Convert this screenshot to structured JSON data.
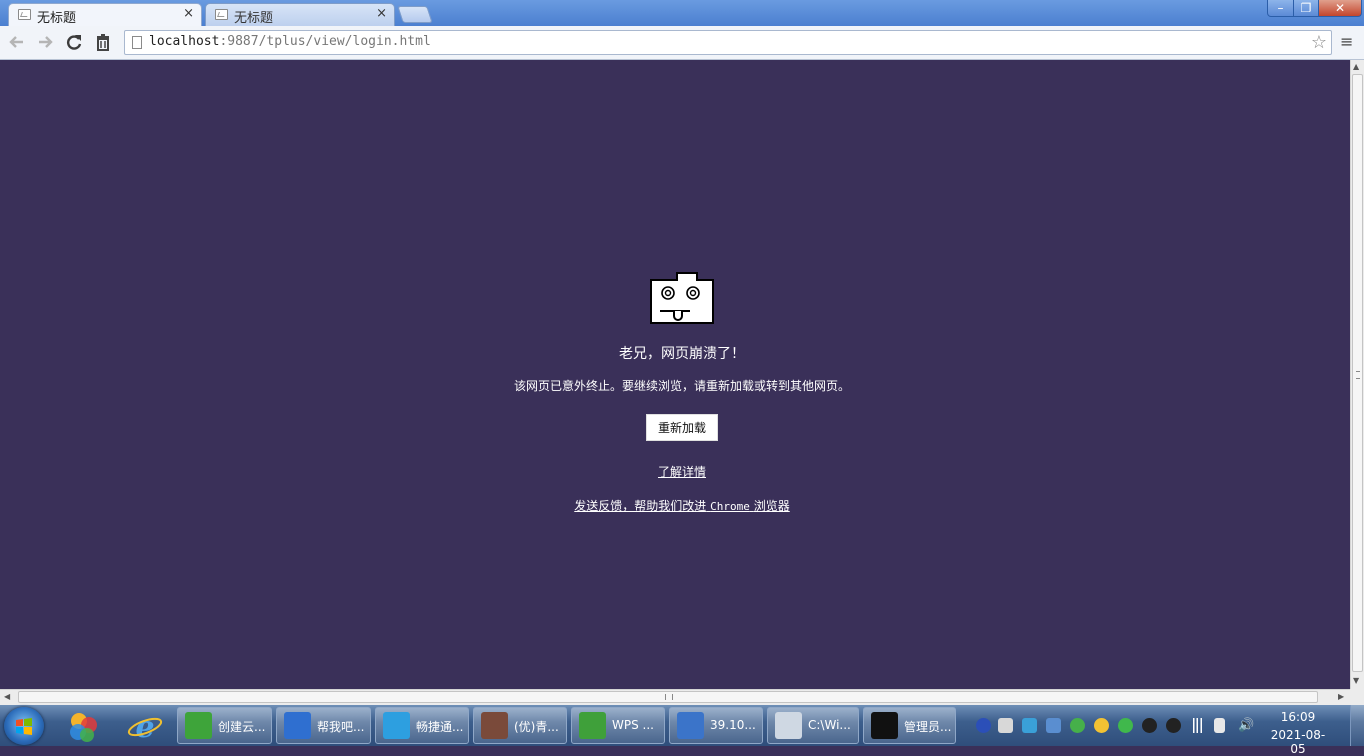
{
  "browser": {
    "tabs": [
      {
        "title": "无标题",
        "close": "×"
      },
      {
        "title": "无标题",
        "close": "×"
      }
    ],
    "window_buttons": {
      "minimize": "–",
      "maximize": "❐",
      "close": "✕"
    },
    "address": {
      "host": "localhost",
      "rest": ":9887/tplus/view/login.html"
    },
    "star": "☆",
    "menu": "≡"
  },
  "crash_page": {
    "title": "老兄，网页崩溃了！",
    "message": "该网页已意外终止。要继续浏览，请重新加载或转到其他网页。",
    "reload_button": "重新加载",
    "learn_more": "了解详情",
    "feedback_prefix": "发送反馈，帮助我们改进",
    "feedback_brand": "Chrome",
    "feedback_suffix": "浏览器"
  },
  "taskbar": {
    "tasks": [
      {
        "label": "创建云...",
        "icon": "green-app-icon",
        "color": "#3ea43a"
      },
      {
        "label": "帮我吧...",
        "icon": "blue-app-icon",
        "color": "#2f6fd0"
      },
      {
        "label": "畅捷通...",
        "icon": "cloud-app-icon",
        "color": "#2d9fe0"
      },
      {
        "label": "(优)青...",
        "icon": "avatar-app-icon",
        "color": "#7a4a3a"
      },
      {
        "label": "WPS ...",
        "icon": "wps-icon",
        "color": "#3fa03a"
      },
      {
        "label": "39.10...",
        "icon": "remote-desktop-icon",
        "color": "#3b74c9"
      },
      {
        "label": "C:\\Wi...",
        "icon": "explorer-window-icon",
        "color": "#cfd8e3"
      },
      {
        "label": "管理员...",
        "icon": "console-icon",
        "color": "#111111"
      }
    ],
    "clock": {
      "time": "16:09",
      "date": "2021-08-05"
    }
  }
}
